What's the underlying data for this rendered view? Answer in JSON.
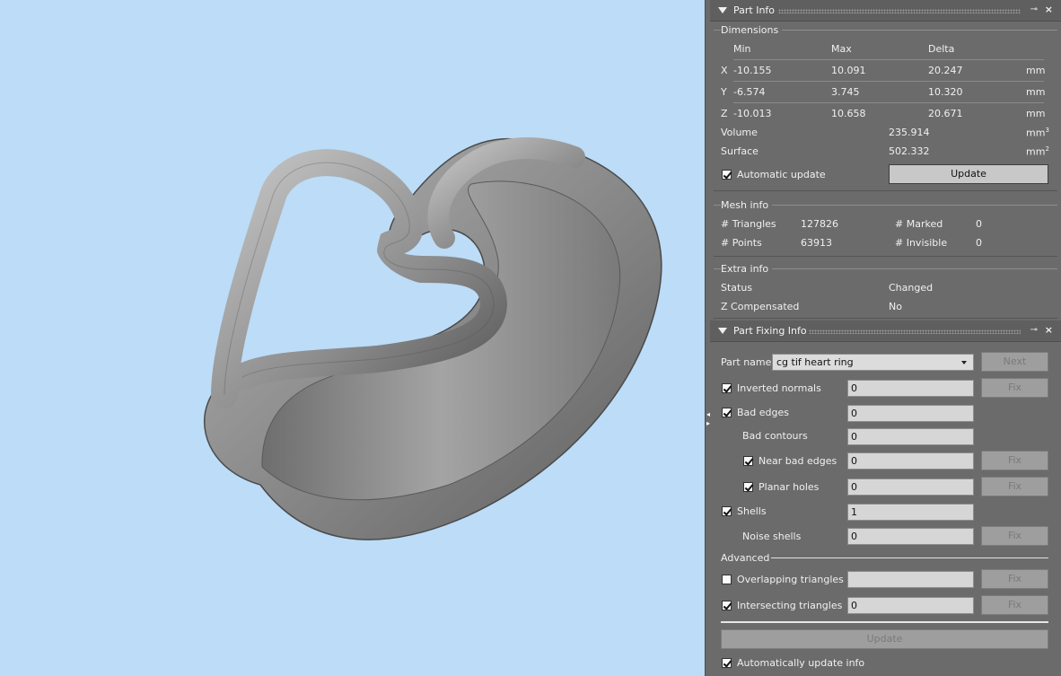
{
  "part_info": {
    "title": "Part Info",
    "dimensions": {
      "group_title": "Dimensions",
      "headers": {
        "min": "Min",
        "max": "Max",
        "delta": "Delta"
      },
      "rows": [
        {
          "axis": "X",
          "min": "-10.155",
          "max": "10.091",
          "delta": "20.247",
          "unit": "mm"
        },
        {
          "axis": "Y",
          "min": "-6.574",
          "max": "3.745",
          "delta": "10.320",
          "unit": "mm"
        },
        {
          "axis": "Z",
          "min": "-10.013",
          "max": "10.658",
          "delta": "20.671",
          "unit": "mm"
        }
      ],
      "volume_label": "Volume",
      "volume_value": "235.914",
      "volume_unit": "mm",
      "volume_exp": "3",
      "surface_label": "Surface",
      "surface_value": "502.332",
      "surface_unit": "mm",
      "surface_exp": "2",
      "auto_update_label": "Automatic update",
      "update_button": "Update"
    },
    "mesh_info": {
      "group_title": "Mesh info",
      "triangles_label": "# Triangles",
      "triangles_value": "127826",
      "marked_label": "# Marked",
      "marked_value": "0",
      "points_label": "# Points",
      "points_value": "63913",
      "invisible_label": "# Invisible",
      "invisible_value": "0"
    },
    "extra_info": {
      "group_title": "Extra info",
      "status_label": "Status",
      "status_value": "Changed",
      "zcomp_label": "Z Compensated",
      "zcomp_value": "No"
    }
  },
  "part_fixing": {
    "title": "Part Fixing Info",
    "part_name_label": "Part name",
    "part_name_value": "cg tif heart ring",
    "next_button": "Next",
    "fix_label": "Fix",
    "inverted_normals_label": "Inverted normals",
    "inverted_normals_value": "0",
    "bad_edges_label": "Bad edges",
    "bad_edges_value": "0",
    "bad_contours_label": "Bad contours",
    "bad_contours_value": "0",
    "near_bad_edges_label": "Near bad edges",
    "near_bad_edges_value": "0",
    "planar_holes_label": "Planar holes",
    "planar_holes_value": "0",
    "shells_label": "Shells",
    "shells_value": "1",
    "noise_shells_label": "Noise shells",
    "noise_shells_value": "0",
    "advanced_label": "Advanced",
    "overlapping_label": "Overlapping triangles",
    "overlapping_value": "",
    "intersecting_label": "Intersecting triangles",
    "intersecting_value": "0",
    "update_button": "Update",
    "auto_update_info_label": "Automatically update info"
  },
  "icons": [
    "collapse-triangle-icon",
    "pin-icon",
    "close-icon",
    "checkbox-icon",
    "dropdown-arrow-icon"
  ],
  "colors": {
    "viewport_bg": "#bcdcf7",
    "panel_bg": "#6b6b6b",
    "model_gray": "#8a8a8a"
  }
}
